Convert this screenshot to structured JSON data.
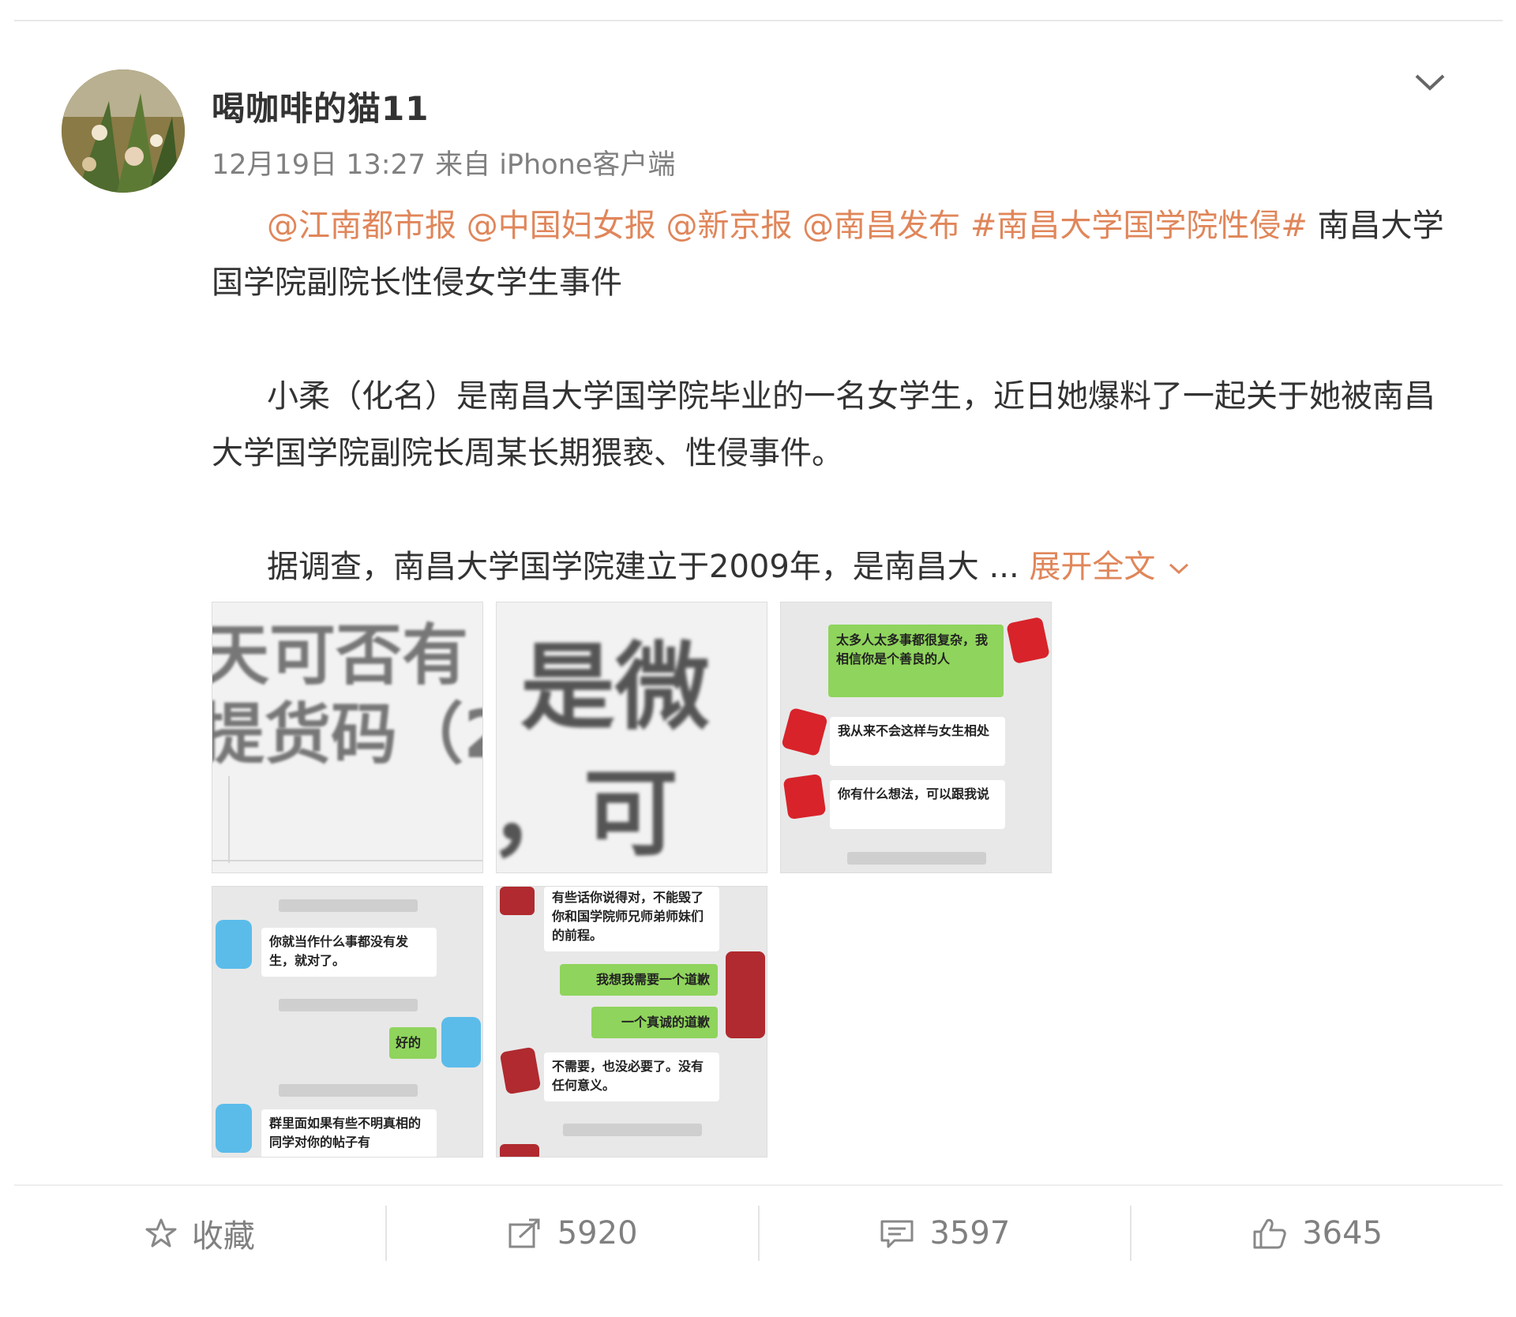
{
  "post": {
    "username": "喝咖啡的猫11",
    "date": "12月19日 13:27",
    "source": "来自 iPhone客户端",
    "mentions": [
      "@江南都市报",
      "@中国妇女报",
      "@新京报",
      "@南昌发布"
    ],
    "hashtag": "#南昌大学国学院性侵#",
    "title_rest": "南昌大学国学院副院长性侵女学生事件",
    "paragraph1": "小柔（化名）是南昌大学国学院毕业的一名女学生，近日她爆料了一起关于她被南昌大学国学院副院长周某长期猥亵、性侵事件。",
    "paragraph2": "据调查，南昌大学国学院建立于2009年，是南昌大 ...",
    "expand_label": "展开全文"
  },
  "thumbnails": {
    "t1": {
      "line1": "天可否有",
      "line2": "提货码（2"
    },
    "t2": {
      "line1": "是微",
      "line2": "，可"
    },
    "t3": {
      "msg1": "太多人太多事都很复杂，我相信你是个善良的人",
      "msg2": "我从来不会这样与女生相处",
      "msg3": "你有什么想法，可以跟我说"
    },
    "t4": {
      "msg1": "你就当作什么事都没有发生，就对了。",
      "msg2": "好的",
      "msg3": "群里面如果有些不明真相的同学对你的帖子有"
    },
    "t5": {
      "msg1": "有些话你说得对，不能毁了你和国学院师兄师弟师妹们的前程。",
      "msg2": "我想我需要一个道歉",
      "msg3": "一个真诚的道歉",
      "msg4": "不需要，也没必要了。没有任何意义。"
    }
  },
  "actions": {
    "favorite": "收藏",
    "repost": "5920",
    "comment": "3597",
    "like": "3645"
  },
  "colors": {
    "link": "#e0865a",
    "text": "#333333",
    "meta": "#808080",
    "bubble_green": "#8fd45c"
  }
}
